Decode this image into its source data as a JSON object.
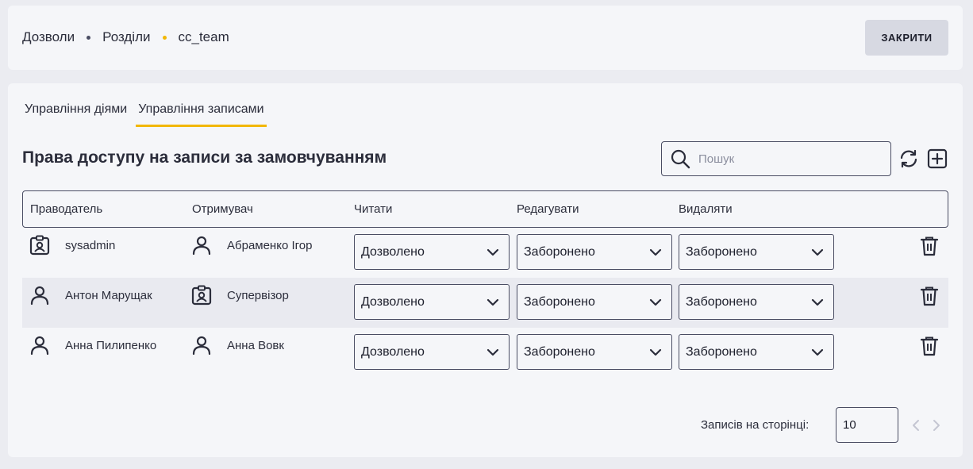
{
  "breadcrumb": {
    "items": [
      "Дозволи",
      "Розділи",
      "cc_team"
    ]
  },
  "header": {
    "close_label": "ЗАКРИТИ"
  },
  "tabs": [
    {
      "label": "Управління діями",
      "active": false
    },
    {
      "label": "Управління записами",
      "active": true
    }
  ],
  "section": {
    "title": "Права доступу на записи за замовчуванням"
  },
  "search": {
    "placeholder": "Пошук",
    "value": ""
  },
  "table": {
    "headers": [
      "Праводатель",
      "Отримувач",
      "Читати",
      "Редагувати",
      "Видаляти"
    ],
    "rows": [
      {
        "grantor": "sysadmin",
        "grantor_icon": "role-badge-icon",
        "grantee": "Абраменко Ігор",
        "grantee_icon": "user-icon",
        "read": "Дозволено",
        "edit": "Заборонено",
        "delete": "Заборонено"
      },
      {
        "grantor": "Антон Марущак",
        "grantor_icon": "user-icon",
        "grantee": "Супервізор",
        "grantee_icon": "role-badge-icon",
        "read": "Дозволено",
        "edit": "Заборонено",
        "delete": "Заборонено"
      },
      {
        "grantor": "Анна Пилипенко",
        "grantor_icon": "user-icon",
        "grantee": "Анна Вовк",
        "grantee_icon": "user-icon",
        "read": "Дозволено",
        "edit": "Заборонено",
        "delete": "Заборонено"
      }
    ]
  },
  "pagination": {
    "label": "Записів на сторінці:",
    "page_size": "10"
  },
  "colors": {
    "accent": "#f2b705",
    "text": "#2b2d3b",
    "panel": "#f5f6f9",
    "background": "#ebecf1"
  }
}
